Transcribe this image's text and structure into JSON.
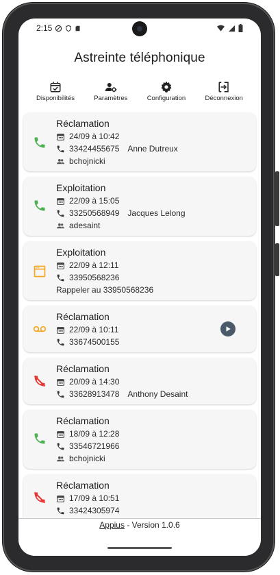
{
  "status_bar": {
    "time": "2:15"
  },
  "app": {
    "title": "Astreinte téléphonique"
  },
  "toolbar": {
    "items": [
      {
        "label": "Disponibilités",
        "icon": "calendar-check-icon"
      },
      {
        "label": "Paramètres",
        "icon": "user-settings-icon"
      },
      {
        "label": "Configuration",
        "icon": "gear-icon"
      },
      {
        "label": "Déconnexion",
        "icon": "logout-icon"
      }
    ]
  },
  "calls": [
    {
      "type": "incoming",
      "category": "Réclamation",
      "date": "24/09 à 10:42",
      "number": "33424455675",
      "contact": "Anne Dutreux",
      "agent": "bchojnicki"
    },
    {
      "type": "incoming",
      "category": "Exploitation",
      "date": "22/09 à 15:05",
      "number": "33250568949",
      "contact": "Jacques Lelong",
      "agent": "adesaint"
    },
    {
      "type": "sms",
      "category": "Exploitation",
      "date": "22/09 à 12:11",
      "number": "33950568236",
      "message": "Rappeler au 33950568236"
    },
    {
      "type": "voicemail",
      "category": "Réclamation",
      "date": "22/09 à 10:11",
      "number": "33674500155"
    },
    {
      "type": "missed",
      "category": "Réclamation",
      "date": "20/09 à 14:30",
      "number": "33628913478",
      "contact": "Anthony Desaint"
    },
    {
      "type": "incoming",
      "category": "Réclamation",
      "date": "18/09 à 12:28",
      "number": "33546721966",
      "agent": "bchojnicki"
    },
    {
      "type": "missed",
      "category": "Réclamation",
      "date": "17/09 à 10:51",
      "number": "33424305974"
    }
  ],
  "footer": {
    "app_name": "Appius",
    "version_text": " - Version 1.0.6"
  },
  "colors": {
    "incoming": "#4caf50",
    "missed": "#e53935",
    "sms": "#f5a623",
    "voicemail": "#f5a623",
    "play": "#4b5a6b",
    "card": "#f6f6f7"
  }
}
